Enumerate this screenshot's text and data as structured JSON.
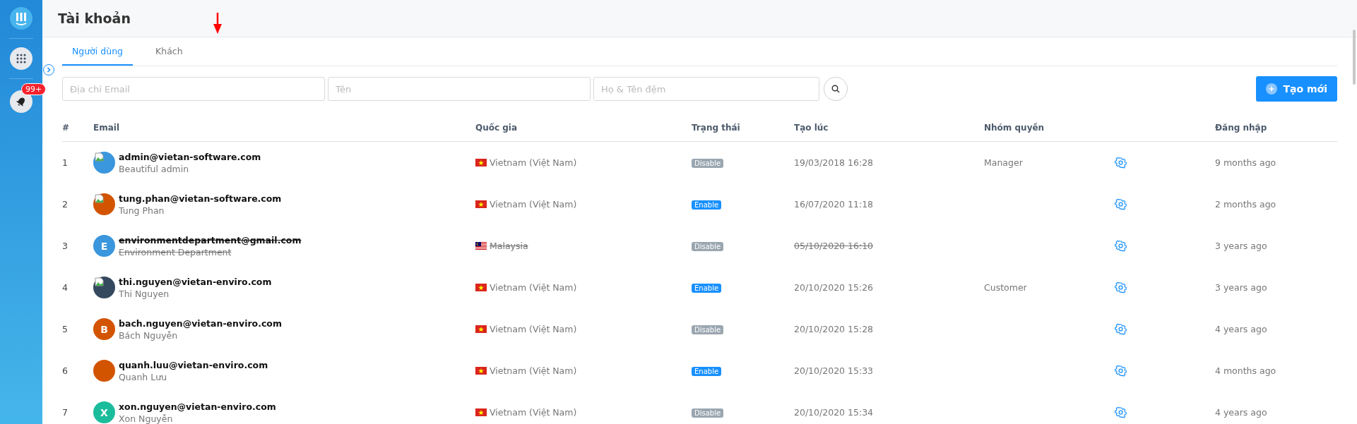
{
  "sidebar": {
    "badge": "99+"
  },
  "page_title": "Tài khoản",
  "tabs": [
    {
      "label": "Người dùng",
      "selected": true
    },
    {
      "label": "Khách",
      "selected": false
    }
  ],
  "filters": [
    {
      "placeholder": "Địa chỉ Email"
    },
    {
      "placeholder": "Tên"
    },
    {
      "placeholder": "Họ & Tên đệm"
    }
  ],
  "create_button": "Tạo mới",
  "table": {
    "columns": [
      "#",
      "Email",
      "Quốc gia",
      "Trạng thái",
      "Tạo lúc",
      "Nhóm quyền",
      "Đăng nhập"
    ],
    "rows": [
      {
        "index": "1",
        "email": "admin@vietan-software.com",
        "name": "Beautiful admin",
        "avatar": {
          "kind": "image",
          "color": "#3a96dd"
        },
        "flag": {
          "kind": "vn"
        },
        "country": "Vietnam (Việt Nam)",
        "status": "Disable",
        "enabled": false,
        "created": "19/03/2018 16:28",
        "group": "Manager",
        "login": "9 months ago",
        "deleted": false
      },
      {
        "index": "2",
        "email": "tung.phan@vietan-software.com",
        "name": "Tung Phan",
        "avatar": {
          "kind": "image",
          "color": "#d35400"
        },
        "flag": {
          "kind": "vn"
        },
        "country": "Vietnam (Việt Nam)",
        "status": "Enable",
        "enabled": true,
        "created": "16/07/2020 11:18",
        "login": "2 months ago",
        "deleted": false
      },
      {
        "index": "3",
        "email": "environmentdepartment@gmail.com",
        "name": "Environment Department",
        "avatar": {
          "kind": "letter",
          "letter": "E",
          "color": "#3a96dd"
        },
        "flag": {
          "kind": "my"
        },
        "country": "Malaysia",
        "status": "Disable",
        "enabled": false,
        "created": "05/10/2020 16:10",
        "login": "3 years ago",
        "deleted": true
      },
      {
        "index": "4",
        "email": "thi.nguyen@vietan-enviro.com",
        "name": "Thi Nguyen",
        "avatar": {
          "kind": "image",
          "color": "#34495e"
        },
        "flag": {
          "kind": "vn"
        },
        "country": "Vietnam (Việt Nam)",
        "status": "Enable",
        "enabled": true,
        "created": "20/10/2020 15:26",
        "group": "Customer",
        "login": "3 years ago",
        "deleted": false
      },
      {
        "index": "5",
        "email": "bach.nguyen@vietan-enviro.com",
        "name": "Bách Nguyễn",
        "avatar": {
          "kind": "letter",
          "letter": "B",
          "color": "#d35400"
        },
        "flag": {
          "kind": "vn"
        },
        "country": "Vietnam (Việt Nam)",
        "status": "Disable",
        "enabled": false,
        "created": "20/10/2020 15:28",
        "login": "4 years ago",
        "deleted": false
      },
      {
        "index": "6",
        "email": "quanh.luu@vietan-enviro.com",
        "name": "Quanh Lưu",
        "avatar": {
          "kind": "plain",
          "color": "#d35400"
        },
        "flag": {
          "kind": "vn"
        },
        "country": "Vietnam (Việt Nam)",
        "status": "Enable",
        "enabled": true,
        "created": "20/10/2020 15:33",
        "login": "4 months ago",
        "deleted": false
      },
      {
        "index": "7",
        "email": "xon.nguyen@vietan-enviro.com",
        "name": "Xon Nguyễn",
        "avatar": {
          "kind": "letter",
          "letter": "X",
          "color": "#1abc9c"
        },
        "flag": {
          "kind": "vn"
        },
        "country": "Vietnam (Việt Nam)",
        "status": "Disable",
        "enabled": false,
        "created": "20/10/2020 15:34",
        "login": "4 years ago",
        "deleted": false
      }
    ]
  }
}
